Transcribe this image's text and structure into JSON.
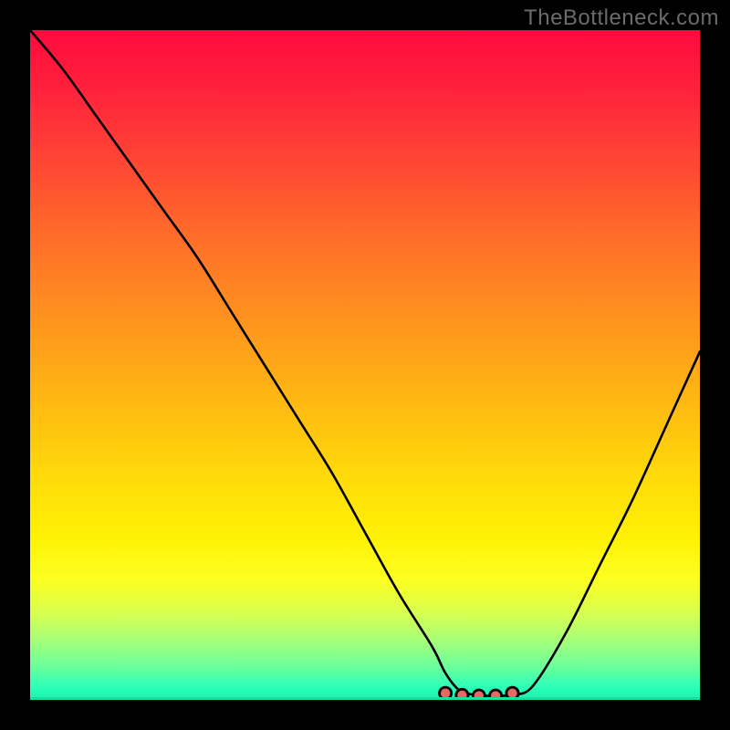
{
  "watermark": "TheBottleneck.com",
  "colors": {
    "frame_background": "#000000",
    "watermark_text": "#6b6b6b",
    "curve_stroke": "#000000",
    "marker_stroke": "#000000",
    "marker_fill": "#e46a63",
    "gradient_top": "#ff0a3e",
    "gradient_mid": "#ffd80a",
    "gradient_bottom": "#14f5ad"
  },
  "chart_data": {
    "type": "line",
    "title": "",
    "xlabel": "",
    "ylabel": "",
    "xlim": [
      0,
      100
    ],
    "ylim": [
      0,
      100
    ],
    "grid": false,
    "legend": false,
    "series": [
      {
        "name": "bottleneck-curve",
        "x": [
          0,
          5,
          10,
          15,
          20,
          25,
          30,
          35,
          40,
          45,
          50,
          55,
          60,
          62,
          64,
          66,
          68,
          70,
          72,
          75,
          80,
          85,
          90,
          95,
          100
        ],
        "y": [
          100,
          94,
          87,
          80,
          73,
          66,
          58,
          50,
          42,
          34,
          25,
          16,
          8,
          4,
          1.5,
          0.8,
          0.6,
          0.6,
          0.8,
          2,
          10,
          20,
          30,
          41,
          52
        ]
      }
    ],
    "markers": [
      {
        "name": "valley-left-end",
        "x": 62.0,
        "y": 1.0
      },
      {
        "name": "valley-mid-1",
        "x": 64.5,
        "y": 0.7
      },
      {
        "name": "valley-mid-2",
        "x": 67.0,
        "y": 0.6
      },
      {
        "name": "valley-mid-3",
        "x": 69.5,
        "y": 0.6
      },
      {
        "name": "valley-right-end",
        "x": 72.0,
        "y": 1.0
      }
    ]
  }
}
